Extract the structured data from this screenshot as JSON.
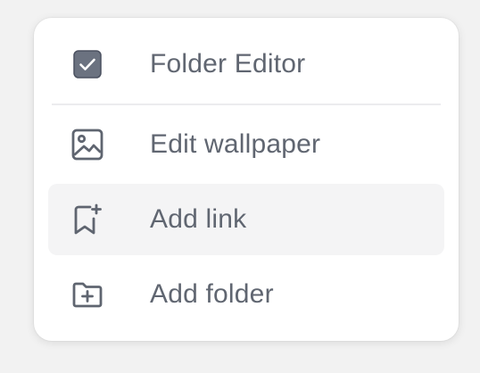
{
  "menu": {
    "folder_editor": {
      "label": "Folder Editor",
      "icon": "checkbox-checked-icon",
      "checked": true
    },
    "edit_wallpaper": {
      "label": "Edit wallpaper",
      "icon": "image-icon"
    },
    "add_link": {
      "label": "Add link",
      "icon": "bookmark-plus-icon",
      "hovered": true
    },
    "add_folder": {
      "label": "Add folder",
      "icon": "folder-plus-icon"
    }
  },
  "colors": {
    "text": "#606671",
    "icon": "#5f6570",
    "checkbox_fill": "#6b7280",
    "hover_bg": "#f4f4f5",
    "menu_bg": "#ffffff",
    "page_bg": "#f2f2f2"
  }
}
